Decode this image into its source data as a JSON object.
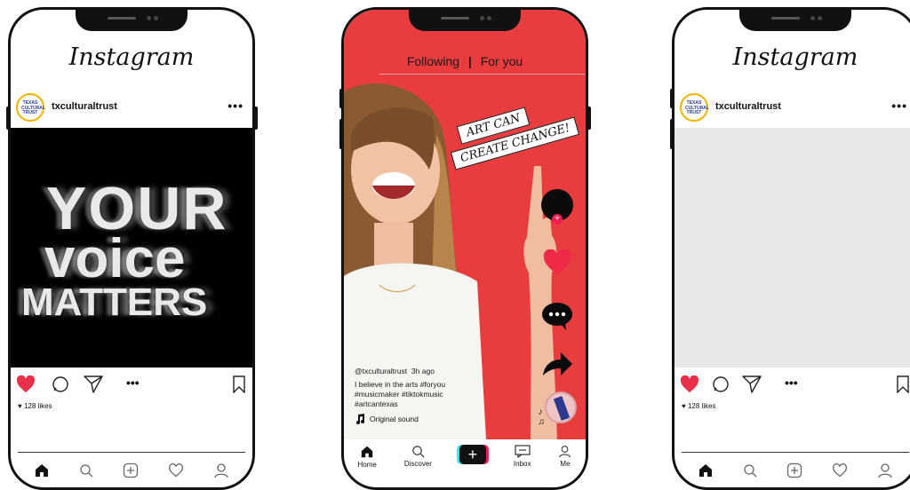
{
  "phone1": {
    "logo": "Instagram",
    "username": "txculturaltrust",
    "avatar_text": [
      "TEXAS",
      "CULTURAL",
      "TRUST"
    ],
    "post_lines": [
      "YOUR",
      "voice",
      "MATTERS"
    ],
    "likes": "128 likes"
  },
  "phone2": {
    "tabs": {
      "following": "Following",
      "separator": "|",
      "for_you": "For you"
    },
    "banner_line1": "ART CAN",
    "banner_line2": "CREATE CHANGE!",
    "caption_user": "@txculturaltrust",
    "caption_time": "3h ago",
    "caption_line1": "I believe in the arts #foryou",
    "caption_line2": "#musicmaker #tiktokmusic",
    "caption_line3": "#artcantexas",
    "sound": "Original sound",
    "nav": {
      "home": "Home",
      "discover": "Discover",
      "inbox": "Inbox",
      "me": "Me"
    }
  },
  "phone3": {
    "logo": "Instagram",
    "username": "txculturaltrust",
    "avatar_text": [
      "TEXAS",
      "CULTURAL",
      "TRUST"
    ],
    "likes": "128 likes"
  },
  "colors": {
    "tiktok_bg": "#e83c3e",
    "heart": "#e8304a",
    "avatar_ring": "#f0b400"
  }
}
